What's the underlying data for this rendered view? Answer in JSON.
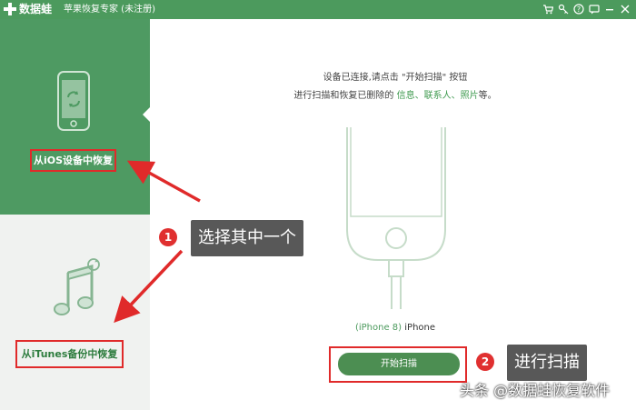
{
  "titlebar": {
    "app_name": "数据蛙",
    "subtitle": "苹果恢复专家 (未注册)",
    "icons": [
      "cart-icon",
      "key-icon",
      "help-icon",
      "chat-icon",
      "minimize-icon",
      "close-icon"
    ]
  },
  "sidebar": {
    "ios_label": "从iOS设备中恢复",
    "itunes_label": "从iTunes备份中恢复"
  },
  "main": {
    "message_line1": "设备已连接,请点击 \"开始扫描\" 按钮",
    "message_line2_prefix": "进行扫描和恢复已删除的 ",
    "message_line2_highlight": "信息、联系人、照片",
    "message_line2_suffix": "等。",
    "device_model": "(iPhone 8)",
    "device_name": " iPhone",
    "scan_button": "开始扫描"
  },
  "annotations": {
    "step1_number": "1",
    "step1_text": "选择其中一个",
    "step2_number": "2",
    "step2_text": "进行扫描"
  },
  "watermark": "头条 @数据蛙恢复软件",
  "colors": {
    "brand_green": "#4c9a5d",
    "highlight_red": "#e02a2a",
    "callout_gray": "#585858"
  }
}
